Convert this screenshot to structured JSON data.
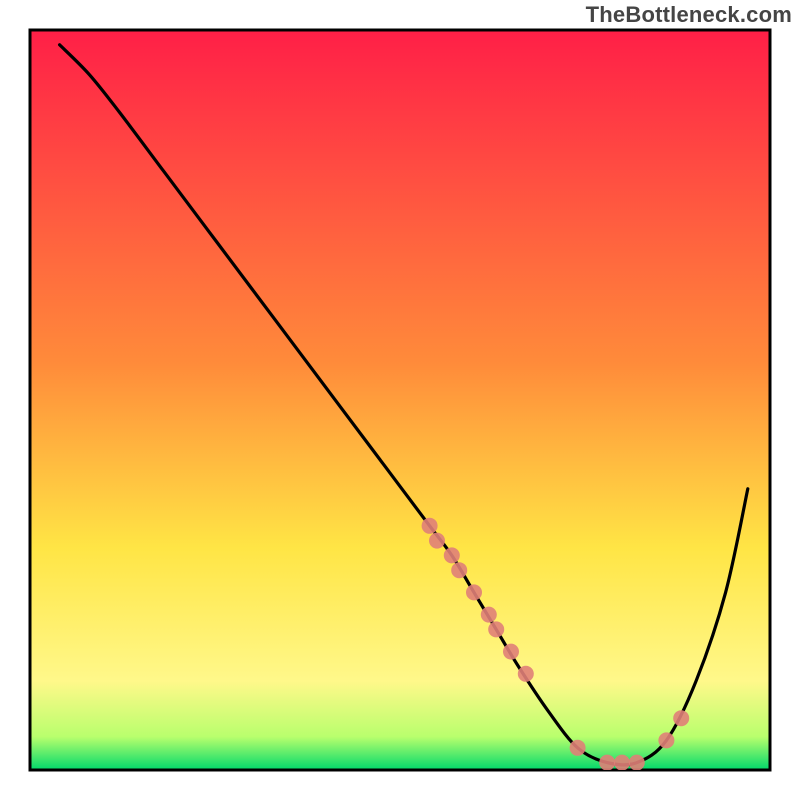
{
  "watermark": "TheBottleneck.com",
  "chart_data": {
    "type": "line",
    "title": "",
    "xlabel": "",
    "ylabel": "",
    "xlim": [
      0,
      100
    ],
    "ylim": [
      0,
      100
    ],
    "grid": false,
    "legend": false,
    "background": {
      "type": "vertical-gradient",
      "stops": [
        {
          "pos": 0.0,
          "color": "#ff1f47"
        },
        {
          "pos": 0.45,
          "color": "#ff8b3a"
        },
        {
          "pos": 0.7,
          "color": "#ffe545"
        },
        {
          "pos": 0.88,
          "color": "#fff88a"
        },
        {
          "pos": 0.955,
          "color": "#b9ff6d"
        },
        {
          "pos": 1.0,
          "color": "#00d96b"
        }
      ]
    },
    "series": [
      {
        "name": "bottleneck-curve",
        "color": "#000000",
        "x": [
          4,
          8,
          12,
          18,
          24,
          30,
          36,
          42,
          48,
          54,
          57,
          60,
          63,
          66,
          70,
          74,
          78,
          82,
          86,
          90,
          94,
          97
        ],
        "y": [
          98,
          94,
          89,
          81,
          73,
          65,
          57,
          49,
          41,
          33,
          29,
          24,
          19,
          14,
          8,
          3,
          1,
          1,
          4,
          12,
          24,
          38
        ]
      }
    ],
    "markers": {
      "name": "highlight-points",
      "color": "#e08078",
      "radius": 8,
      "x": [
        54,
        55,
        57,
        58,
        60,
        62,
        63,
        65,
        67,
        74,
        78,
        80,
        82,
        86,
        88
      ],
      "y": [
        33,
        31,
        29,
        27,
        24,
        21,
        19,
        16,
        13,
        3,
        1,
        1,
        1,
        4,
        7
      ]
    }
  }
}
